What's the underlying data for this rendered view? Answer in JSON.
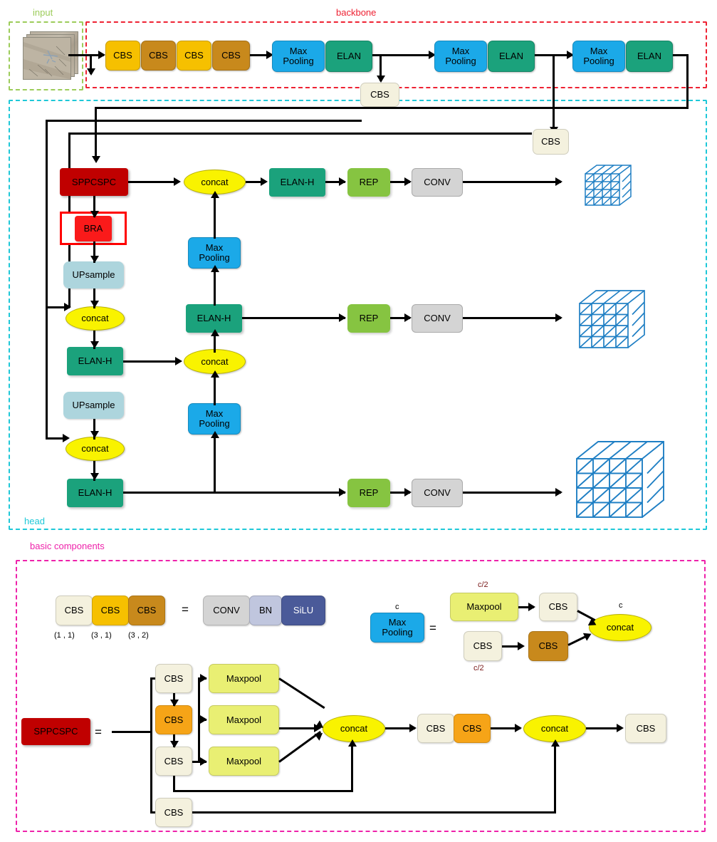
{
  "sections": {
    "input": {
      "label": "input",
      "color": "#9ccc5a"
    },
    "backbone": {
      "label": "backbone",
      "color": "#ee2233"
    },
    "head": {
      "label": "head",
      "color": "#1ec8d8"
    },
    "basic": {
      "label": "basic components",
      "color": "#ee22aa"
    }
  },
  "palette": {
    "cbs_cream": "#f4f1de",
    "cbs_gold": "#f6c000",
    "cbs_brown": "#c8891c",
    "cbs_orange": "#f6a417",
    "maxpool_blue": "#1ba9e8",
    "maxpool_yellow": "#e9ef73",
    "elan_green": "#1ba27c",
    "rep_green": "#86c441",
    "conv_grey": "#d4d4d4",
    "bn_grey": "#c0c6de",
    "silu_navy": "#4a5a99",
    "sppcspc_darkred": "#c00000",
    "bra_red": "#fa1a1a",
    "upsample_blue": "#add5dd",
    "concat_yellow": "#f9f300",
    "cube_blue": "#1f7fc4"
  },
  "backbone": {
    "cbs": [
      {
        "label": "CBS"
      },
      {
        "label": "CBS"
      },
      {
        "label": "CBS"
      },
      {
        "label": "CBS"
      }
    ],
    "stages": [
      {
        "pool": "Max\nPooling",
        "elan": "ELAN"
      },
      {
        "pool": "Max\nPooling",
        "elan": "ELAN"
      },
      {
        "pool": "Max\nPooling",
        "elan": "ELAN"
      }
    ],
    "pool_line1": "Max",
    "pool_line2": "Pooling",
    "elan_label": "ELAN",
    "bridge_cbs": "CBS"
  },
  "head": {
    "cbs_right": "CBS",
    "sppcspc": "SPPCSPC",
    "bra": "BRA",
    "upsample": "UPsample",
    "concat": "concat",
    "elan_h": "ELAN-H",
    "rep": "REP",
    "conv": "CONV",
    "pool_line1": "Max",
    "pool_line2": "Pooling"
  },
  "basic": {
    "cbs_row": [
      {
        "label": "CBS",
        "params": "(1 , 1)"
      },
      {
        "label": "CBS",
        "params": "(3 , 1)"
      },
      {
        "label": "CBS",
        "params": "(3 , 2)"
      }
    ],
    "equals": "=",
    "conv": "CONV",
    "bn": "BN",
    "silu": "SiLU",
    "maxpool_block": {
      "line1": "Max",
      "line2": "Pooling",
      "in_label": "c"
    },
    "maxpool_expand": {
      "top_label": "c/2",
      "bottom_label": "c/2",
      "out_label": "c",
      "maxpool": "Maxpool",
      "cbs_top": "CBS",
      "cbs_bot_a": "CBS",
      "cbs_bot_b": "CBS",
      "concat": "concat"
    },
    "sppcspc_expand": {
      "title": "SPPCSPC",
      "cbs_a": "CBS",
      "cbs_b": "CBS",
      "cbs_c": "CBS",
      "cbs_skip": "CBS",
      "maxpool1": "Maxpool",
      "maxpool2": "Maxpool",
      "maxpool3": "Maxpool",
      "concat1": "concat",
      "cbs_d": "CBS",
      "cbs_e": "CBS",
      "concat2": "concat",
      "cbs_f": "CBS"
    }
  },
  "outputs": {
    "cube_small": "feature-map-small",
    "cube_medium": "feature-map-medium",
    "cube_large": "feature-map-large"
  }
}
